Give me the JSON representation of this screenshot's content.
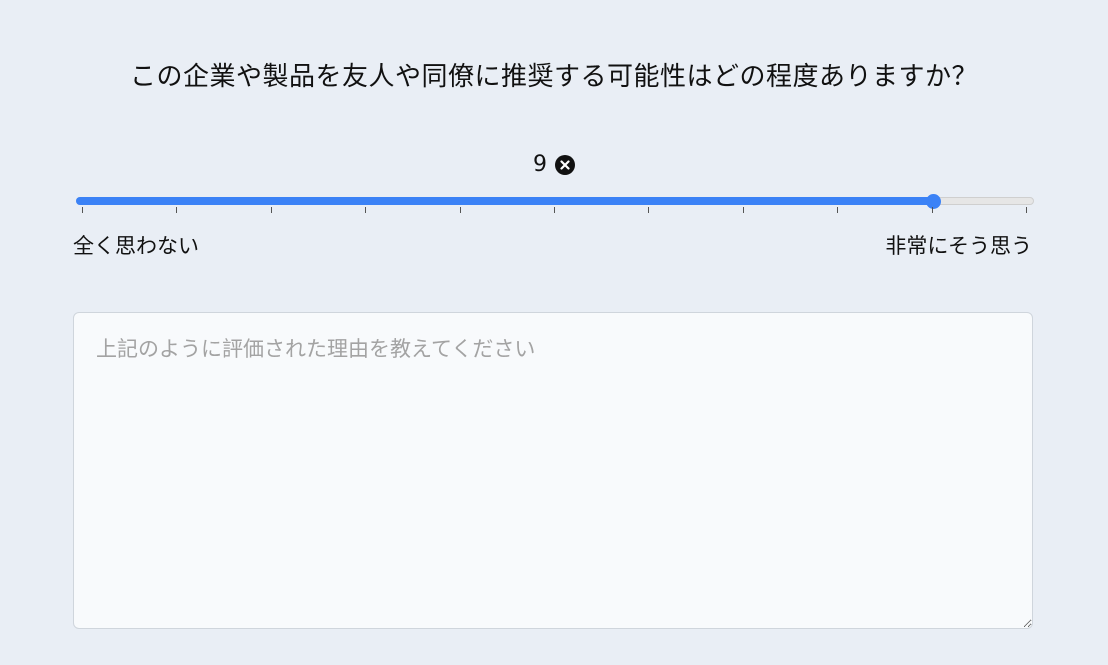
{
  "survey": {
    "question": "この企業や製品を友人や同僚に推奨する可能性はどの程度ありますか？",
    "slider": {
      "value": 9,
      "min": 0,
      "max": 10,
      "value_label": "9",
      "min_label": "全く思わない",
      "max_label": "非常にそう思う",
      "fill_color": "#3b82f6",
      "clear_icon": "times-circle-icon"
    },
    "reason": {
      "placeholder": "上記のように評価された理由を教えてください",
      "value": ""
    }
  }
}
